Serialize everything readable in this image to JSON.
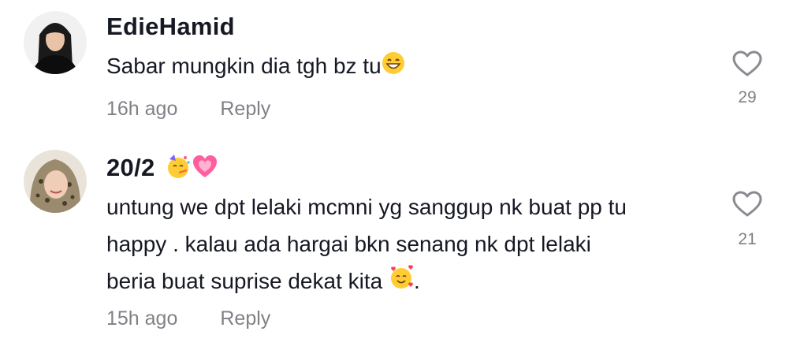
{
  "comments": [
    {
      "author": "EdieHamid",
      "author_emojis": [],
      "text": "Sabar mungkin dia tgh bz tu",
      "text_emoji": "grinning-face-with-smiling-eyes",
      "time": "16h ago",
      "reply_label": "Reply",
      "likes": "29"
    },
    {
      "author": "20/2",
      "author_emojis": [
        "partying-face",
        "growing-heart"
      ],
      "text_lines": [
        "untung we dpt lelaki mcmni yg sanggup nk buat pp tu",
        "happy . kalau ada hargai bkn senang nk dpt lelaki",
        "beria buat suprise dekat kita"
      ],
      "text_tail": ".",
      "text_emoji": "smiling-face-with-hearts",
      "time": "15h ago",
      "reply_label": "Reply",
      "likes": "21"
    }
  ],
  "colors": {
    "primary_text": "#161823",
    "secondary_text": "#8a8b91",
    "heart_outline": "#8a8b91"
  }
}
